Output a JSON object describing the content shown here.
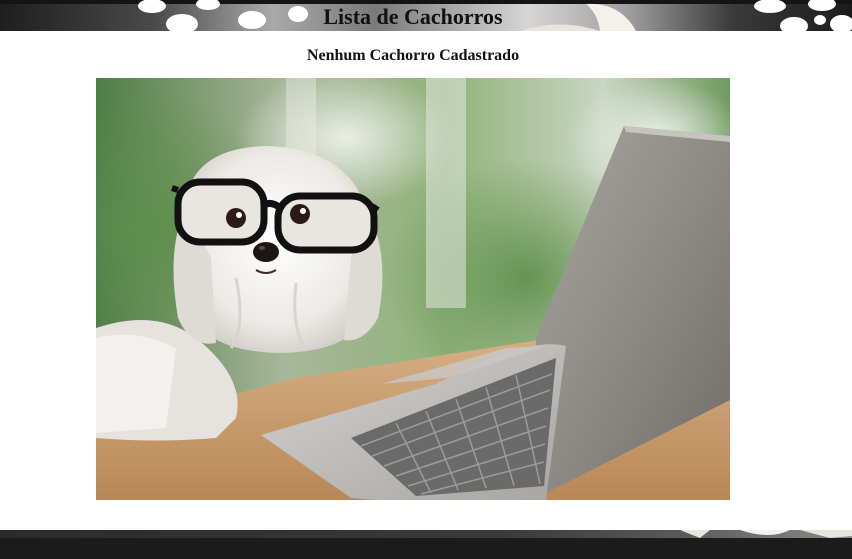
{
  "header": {
    "title": "Lista de Cachorros"
  },
  "main": {
    "empty_message": "Nenhum Cachorro Cadastrado",
    "image": {
      "subject": "dog-with-glasses-at-laptop",
      "description_hidden": ""
    }
  },
  "colors": {
    "header_dark": "#1e1e1e",
    "header_light": "#d6d6d6",
    "footer": "#1b1b1b",
    "text": "#111111",
    "background": "#ffffff"
  }
}
